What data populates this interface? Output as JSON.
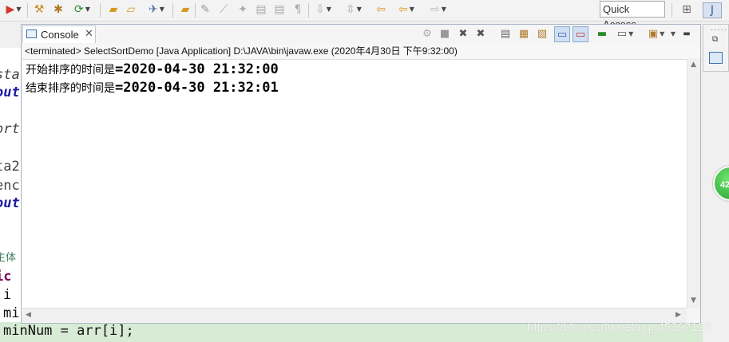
{
  "toolbar": {
    "quick_access_label": "Quick Access",
    "icons": [
      "run-icon",
      "build-icon",
      "package-icon",
      "refresh-icon",
      "open-folder-icon",
      "open-type-icon",
      "search-icon",
      "annotation-icon",
      "pen-icon",
      "toggle-block-icon",
      "outline-icon",
      "show-whitespace-icon",
      "next-annotation-icon",
      "prev-annotation-icon",
      "last-edit-icon",
      "back-icon",
      "forward-icon",
      "perspective-icon",
      "java-perspective-icon"
    ]
  },
  "console": {
    "tab_label": "Console",
    "status": "<terminated> SelectSortDemo [Java Application] D:\\JAVA\\bin\\javaw.exe (2020年4月30日 下午9:32:00)",
    "lines": [
      {
        "label": "开始排序的时间是",
        "value": "=2020-04-30 21:32:00"
      },
      {
        "label": "结束排序的时间是",
        "value": "=2020-04-30 21:32:01"
      }
    ]
  },
  "editor": {
    "fragments": [
      {
        "text": "sta",
        "color": "#444444"
      },
      {
        "text": "out",
        "color": "#1a1aa6"
      },
      {
        "text": "ort",
        "color": "#444444"
      },
      {
        "text": "ta2",
        "color": "#444444"
      },
      {
        "text": "enc",
        "color": "#444444"
      },
      {
        "text": "out",
        "color": "#1a1aa6"
      },
      {
        "text": "主体",
        "color": "#3f7f5f"
      },
      {
        "text": "ic",
        "color": "#7f0055"
      },
      {
        "text": "i",
        "color": "#111111"
      },
      {
        "text": "mi",
        "color": "#111111"
      },
      {
        "text": "minNum = arr[i];",
        "color": "#111111"
      }
    ]
  },
  "badge": {
    "text": "42"
  },
  "watermark": "https://blog.csdn.net/qq_45397122"
}
